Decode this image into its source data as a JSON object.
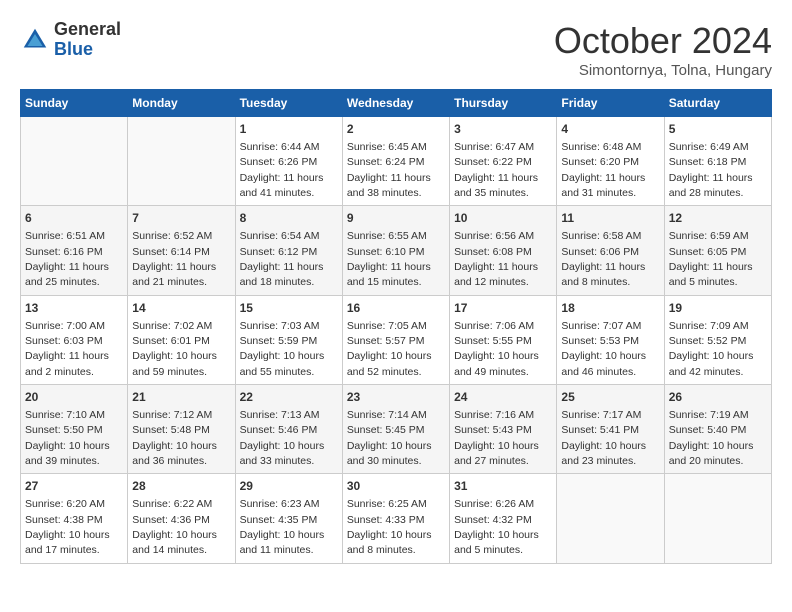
{
  "header": {
    "logo": {
      "general": "General",
      "blue": "Blue"
    },
    "title": "October 2024",
    "location": "Simontornya, Tolna, Hungary"
  },
  "calendar": {
    "days_of_week": [
      "Sunday",
      "Monday",
      "Tuesday",
      "Wednesday",
      "Thursday",
      "Friday",
      "Saturday"
    ],
    "weeks": [
      [
        {
          "day": "",
          "info": ""
        },
        {
          "day": "",
          "info": ""
        },
        {
          "day": "1",
          "info": "Sunrise: 6:44 AM\nSunset: 6:26 PM\nDaylight: 11 hours and 41 minutes."
        },
        {
          "day": "2",
          "info": "Sunrise: 6:45 AM\nSunset: 6:24 PM\nDaylight: 11 hours and 38 minutes."
        },
        {
          "day": "3",
          "info": "Sunrise: 6:47 AM\nSunset: 6:22 PM\nDaylight: 11 hours and 35 minutes."
        },
        {
          "day": "4",
          "info": "Sunrise: 6:48 AM\nSunset: 6:20 PM\nDaylight: 11 hours and 31 minutes."
        },
        {
          "day": "5",
          "info": "Sunrise: 6:49 AM\nSunset: 6:18 PM\nDaylight: 11 hours and 28 minutes."
        }
      ],
      [
        {
          "day": "6",
          "info": "Sunrise: 6:51 AM\nSunset: 6:16 PM\nDaylight: 11 hours and 25 minutes."
        },
        {
          "day": "7",
          "info": "Sunrise: 6:52 AM\nSunset: 6:14 PM\nDaylight: 11 hours and 21 minutes."
        },
        {
          "day": "8",
          "info": "Sunrise: 6:54 AM\nSunset: 6:12 PM\nDaylight: 11 hours and 18 minutes."
        },
        {
          "day": "9",
          "info": "Sunrise: 6:55 AM\nSunset: 6:10 PM\nDaylight: 11 hours and 15 minutes."
        },
        {
          "day": "10",
          "info": "Sunrise: 6:56 AM\nSunset: 6:08 PM\nDaylight: 11 hours and 12 minutes."
        },
        {
          "day": "11",
          "info": "Sunrise: 6:58 AM\nSunset: 6:06 PM\nDaylight: 11 hours and 8 minutes."
        },
        {
          "day": "12",
          "info": "Sunrise: 6:59 AM\nSunset: 6:05 PM\nDaylight: 11 hours and 5 minutes."
        }
      ],
      [
        {
          "day": "13",
          "info": "Sunrise: 7:00 AM\nSunset: 6:03 PM\nDaylight: 11 hours and 2 minutes."
        },
        {
          "day": "14",
          "info": "Sunrise: 7:02 AM\nSunset: 6:01 PM\nDaylight: 10 hours and 59 minutes."
        },
        {
          "day": "15",
          "info": "Sunrise: 7:03 AM\nSunset: 5:59 PM\nDaylight: 10 hours and 55 minutes."
        },
        {
          "day": "16",
          "info": "Sunrise: 7:05 AM\nSunset: 5:57 PM\nDaylight: 10 hours and 52 minutes."
        },
        {
          "day": "17",
          "info": "Sunrise: 7:06 AM\nSunset: 5:55 PM\nDaylight: 10 hours and 49 minutes."
        },
        {
          "day": "18",
          "info": "Sunrise: 7:07 AM\nSunset: 5:53 PM\nDaylight: 10 hours and 46 minutes."
        },
        {
          "day": "19",
          "info": "Sunrise: 7:09 AM\nSunset: 5:52 PM\nDaylight: 10 hours and 42 minutes."
        }
      ],
      [
        {
          "day": "20",
          "info": "Sunrise: 7:10 AM\nSunset: 5:50 PM\nDaylight: 10 hours and 39 minutes."
        },
        {
          "day": "21",
          "info": "Sunrise: 7:12 AM\nSunset: 5:48 PM\nDaylight: 10 hours and 36 minutes."
        },
        {
          "day": "22",
          "info": "Sunrise: 7:13 AM\nSunset: 5:46 PM\nDaylight: 10 hours and 33 minutes."
        },
        {
          "day": "23",
          "info": "Sunrise: 7:14 AM\nSunset: 5:45 PM\nDaylight: 10 hours and 30 minutes."
        },
        {
          "day": "24",
          "info": "Sunrise: 7:16 AM\nSunset: 5:43 PM\nDaylight: 10 hours and 27 minutes."
        },
        {
          "day": "25",
          "info": "Sunrise: 7:17 AM\nSunset: 5:41 PM\nDaylight: 10 hours and 23 minutes."
        },
        {
          "day": "26",
          "info": "Sunrise: 7:19 AM\nSunset: 5:40 PM\nDaylight: 10 hours and 20 minutes."
        }
      ],
      [
        {
          "day": "27",
          "info": "Sunrise: 6:20 AM\nSunset: 4:38 PM\nDaylight: 10 hours and 17 minutes."
        },
        {
          "day": "28",
          "info": "Sunrise: 6:22 AM\nSunset: 4:36 PM\nDaylight: 10 hours and 14 minutes."
        },
        {
          "day": "29",
          "info": "Sunrise: 6:23 AM\nSunset: 4:35 PM\nDaylight: 10 hours and 11 minutes."
        },
        {
          "day": "30",
          "info": "Sunrise: 6:25 AM\nSunset: 4:33 PM\nDaylight: 10 hours and 8 minutes."
        },
        {
          "day": "31",
          "info": "Sunrise: 6:26 AM\nSunset: 4:32 PM\nDaylight: 10 hours and 5 minutes."
        },
        {
          "day": "",
          "info": ""
        },
        {
          "day": "",
          "info": ""
        }
      ]
    ]
  }
}
